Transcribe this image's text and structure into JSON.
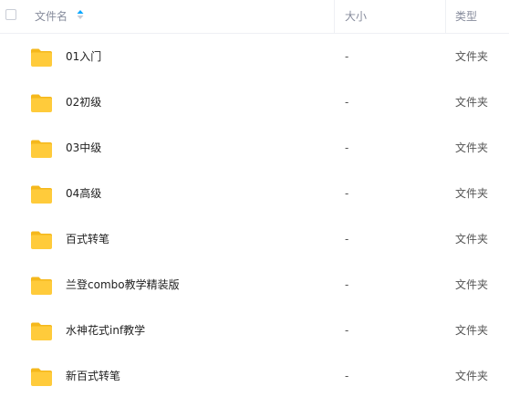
{
  "header": {
    "name_label": "文件名",
    "size_label": "大小",
    "type_label": "类型",
    "sort_icon": "sort-arrows-icon"
  },
  "files": [
    {
      "name": "01入门",
      "size": "-",
      "type": "文件夹",
      "icon": "folder-icon"
    },
    {
      "name": "02初级",
      "size": "-",
      "type": "文件夹",
      "icon": "folder-icon"
    },
    {
      "name": "03中级",
      "size": "-",
      "type": "文件夹",
      "icon": "folder-icon"
    },
    {
      "name": "04高级",
      "size": "-",
      "type": "文件夹",
      "icon": "folder-icon"
    },
    {
      "name": "百式转笔",
      "size": "-",
      "type": "文件夹",
      "icon": "folder-icon"
    },
    {
      "name": "兰登combo教学精装版",
      "size": "-",
      "type": "文件夹",
      "icon": "folder-icon"
    },
    {
      "name": "水神花式inf教学",
      "size": "-",
      "type": "文件夹",
      "icon": "folder-icon"
    },
    {
      "name": "新百式转笔",
      "size": "-",
      "type": "文件夹",
      "icon": "folder-icon"
    }
  ],
  "colors": {
    "folder": "#ffcb3b",
    "folder_tab": "#f5b81c",
    "sort_active": "#06a7ff",
    "sort_inactive": "#c7cbd4"
  }
}
